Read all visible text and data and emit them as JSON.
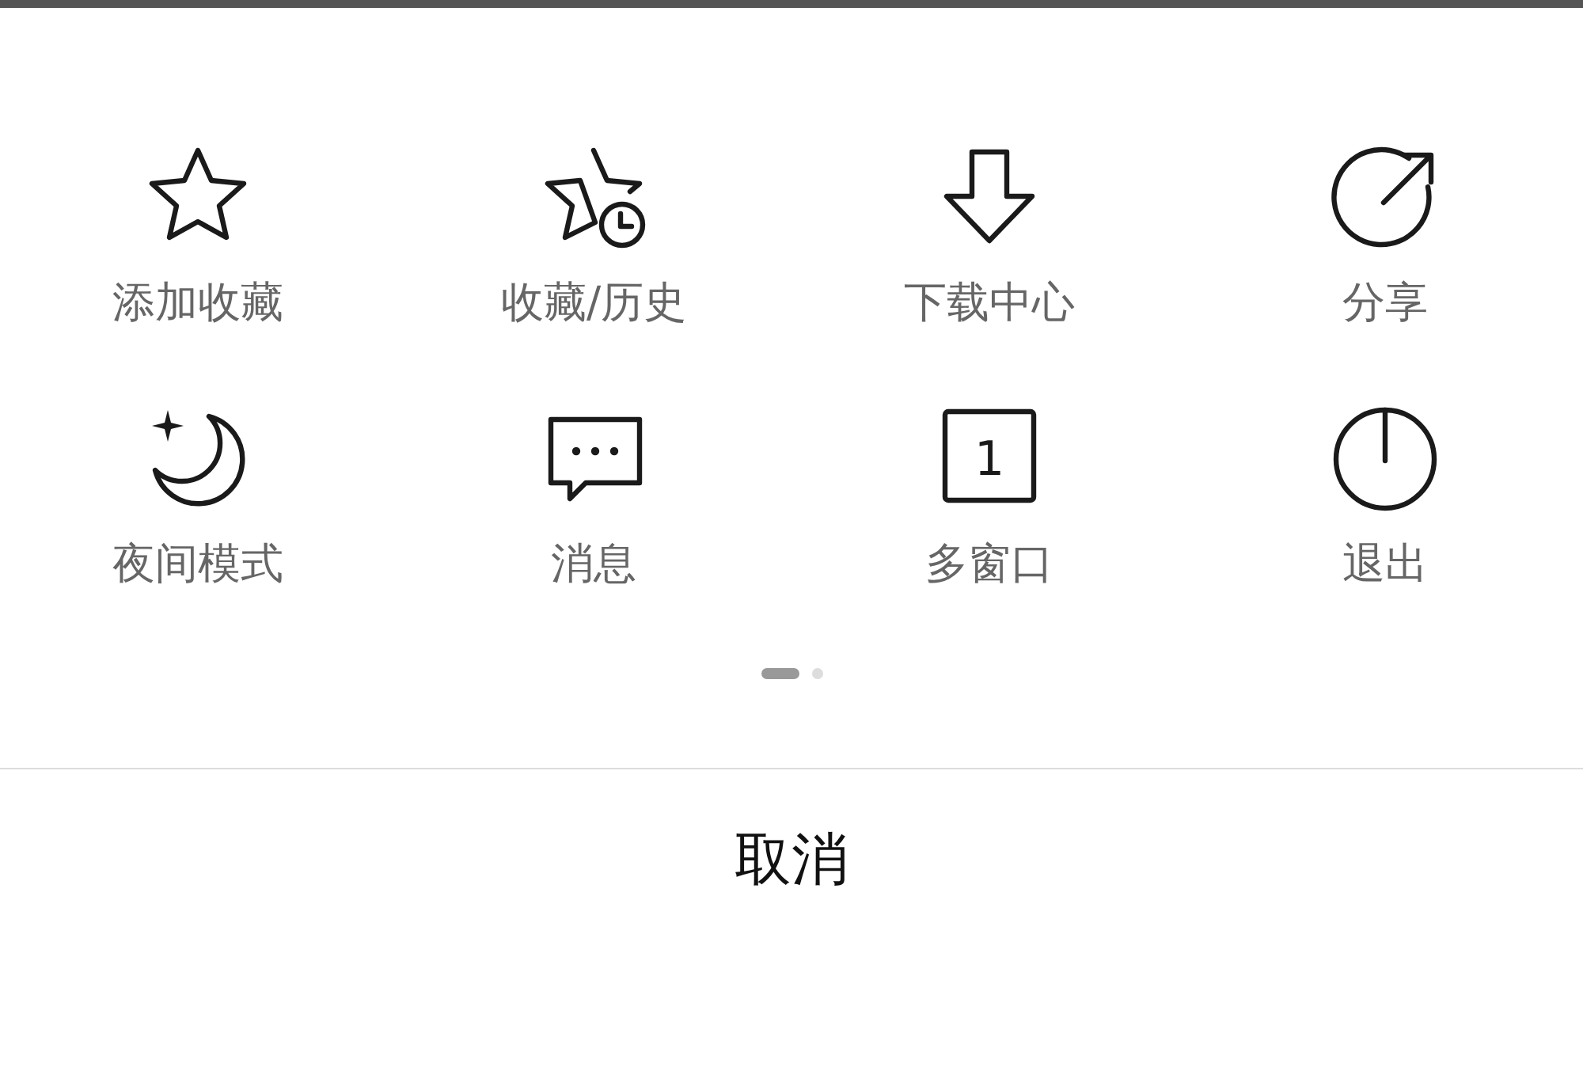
{
  "menu_items": [
    {
      "kind": "star",
      "label": "添加收藏"
    },
    {
      "kind": "star-clock",
      "label": "收藏/历史"
    },
    {
      "kind": "download",
      "label": "下载中心"
    },
    {
      "kind": "share",
      "label": "分享"
    },
    {
      "kind": "moon",
      "label": "夜间模式"
    },
    {
      "kind": "message",
      "label": "消息"
    },
    {
      "kind": "window",
      "label": "多窗口",
      "badge": "1"
    },
    {
      "kind": "power",
      "label": "退出"
    }
  ],
  "page_dots": [
    {
      "selected": true
    },
    {
      "selected": false
    }
  ],
  "cancel_button": "取消"
}
